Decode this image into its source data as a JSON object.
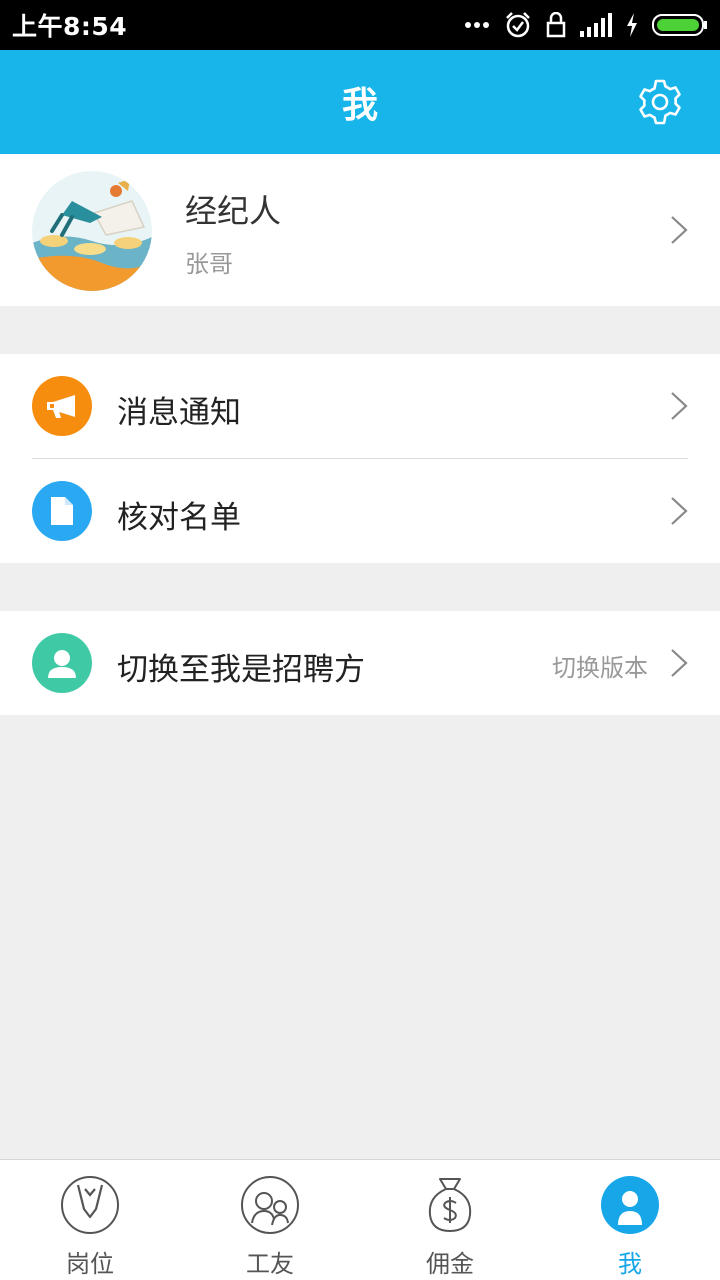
{
  "status_bar": {
    "time": "上午8:54",
    "icons": [
      "more-dots-icon",
      "alarm-icon",
      "lock-icon",
      "signal-icon",
      "charging-icon",
      "battery-icon"
    ],
    "battery_color": "#4cd137"
  },
  "header": {
    "title": "我",
    "background": "#17b5ea",
    "settings_icon": "gear-icon"
  },
  "profile": {
    "name": "经纪人",
    "subtitle": "张哥",
    "avatar_icon": "avatar-illustration"
  },
  "menu_groups": [
    {
      "items": [
        {
          "label": "消息通知",
          "icon": "megaphone-icon",
          "icon_color": "#f68d0e"
        },
        {
          "label": "核对名单",
          "icon": "document-icon",
          "icon_color": "#2aa9f2"
        }
      ]
    },
    {
      "items": [
        {
          "label": "切换至我是招聘方",
          "hint": "切换版本",
          "icon": "user-icon",
          "icon_color": "#3fc9a4"
        }
      ]
    }
  ],
  "bottom_nav": {
    "items": [
      {
        "label": "岗位",
        "icon": "tie-icon",
        "active": false
      },
      {
        "label": "工友",
        "icon": "friends-icon",
        "active": false
      },
      {
        "label": "佣金",
        "icon": "money-bag-icon",
        "active": false
      },
      {
        "label": "我",
        "icon": "me-icon",
        "active": true
      }
    ],
    "active_color": "#17a6e8"
  }
}
